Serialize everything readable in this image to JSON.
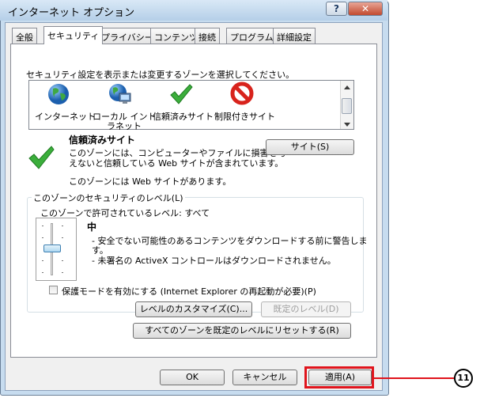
{
  "window": {
    "title": "インターネット オプション",
    "help_glyph": "?",
    "close_glyph": "✕"
  },
  "tabs": [
    {
      "label": "全般",
      "active": false
    },
    {
      "label": "セキュリティ",
      "active": true
    },
    {
      "label": "プライバシー",
      "active": false
    },
    {
      "label": "コンテンツ",
      "active": false
    },
    {
      "label": "接続",
      "active": false
    },
    {
      "label": "プログラム",
      "active": false
    },
    {
      "label": "詳細設定",
      "active": false
    }
  ],
  "security": {
    "prompt": "セキュリティ設定を表示または変更するゾーンを選択してください。",
    "zones": [
      {
        "label": "インターネット",
        "icon": "globe-icon"
      },
      {
        "label_line1": "ローカル イント",
        "label_line2": "ラネット",
        "icon": "local-intranet-icon"
      },
      {
        "label": "信頼済みサイト",
        "icon": "green-check-icon",
        "selected": true
      },
      {
        "label": "制限付きサイト",
        "icon": "no-entry-icon"
      }
    ],
    "selected_zone": {
      "name": "信頼済みサイト",
      "desc_line1": "このゾーンには、コンピューターやファイルに損害を与",
      "desc_line2": "えないと信頼している Web サイトが含まれています。",
      "has_sites": "このゾーンには Web サイトがあります。",
      "sites_button": "サイト(S)"
    },
    "level_group": {
      "legend": "このゾーンのセキュリティのレベル(L)",
      "allowed_levels": "このゾーンで許可されているレベル: すべて",
      "level_name": "中",
      "bullet1_line1": "- 安全でない可能性のあるコンテンツをダウンロードする前に警告しま",
      "bullet1_line2": "す。",
      "bullet2": "- 未署名の ActiveX コントロールはダウンロードされません。",
      "protected_mode": "保護モードを有効にする (Internet Explorer の再起動が必要)(P)",
      "protected_mode_checked": false,
      "custom_button": "レベルのカスタマイズ(C)...",
      "default_button": "既定のレベル(D)",
      "slider_level_fraction": 0.5
    },
    "reset_button": "すべてのゾーンを既定のレベルにリセットする(R)"
  },
  "footer": {
    "ok": "OK",
    "cancel": "キャンセル",
    "apply": "適用(A)"
  },
  "annotation": {
    "number": "11",
    "color": "#e0141c"
  }
}
